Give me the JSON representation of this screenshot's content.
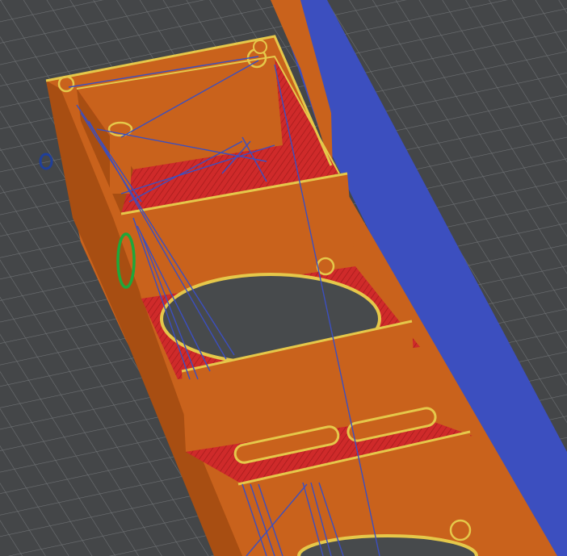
{
  "viewport": {
    "kind": "slicer-gcode-preview",
    "colors": {
      "bed_background": "#444648",
      "grid_line": "#6f7275",
      "outer_wall": "#c9621c",
      "outer_wall_dark": "#a84e12",
      "perimeter_highlight": "#e5c84a",
      "infill": "#cf2a2a",
      "travel_moves": "#3c4fbf",
      "seam_marker": "#1ea83a",
      "marker_blue": "#1f3f9a"
    },
    "icons": {
      "seam_marker": "green-ellipse-icon",
      "origin_marker": "blue-circle-icon"
    }
  }
}
